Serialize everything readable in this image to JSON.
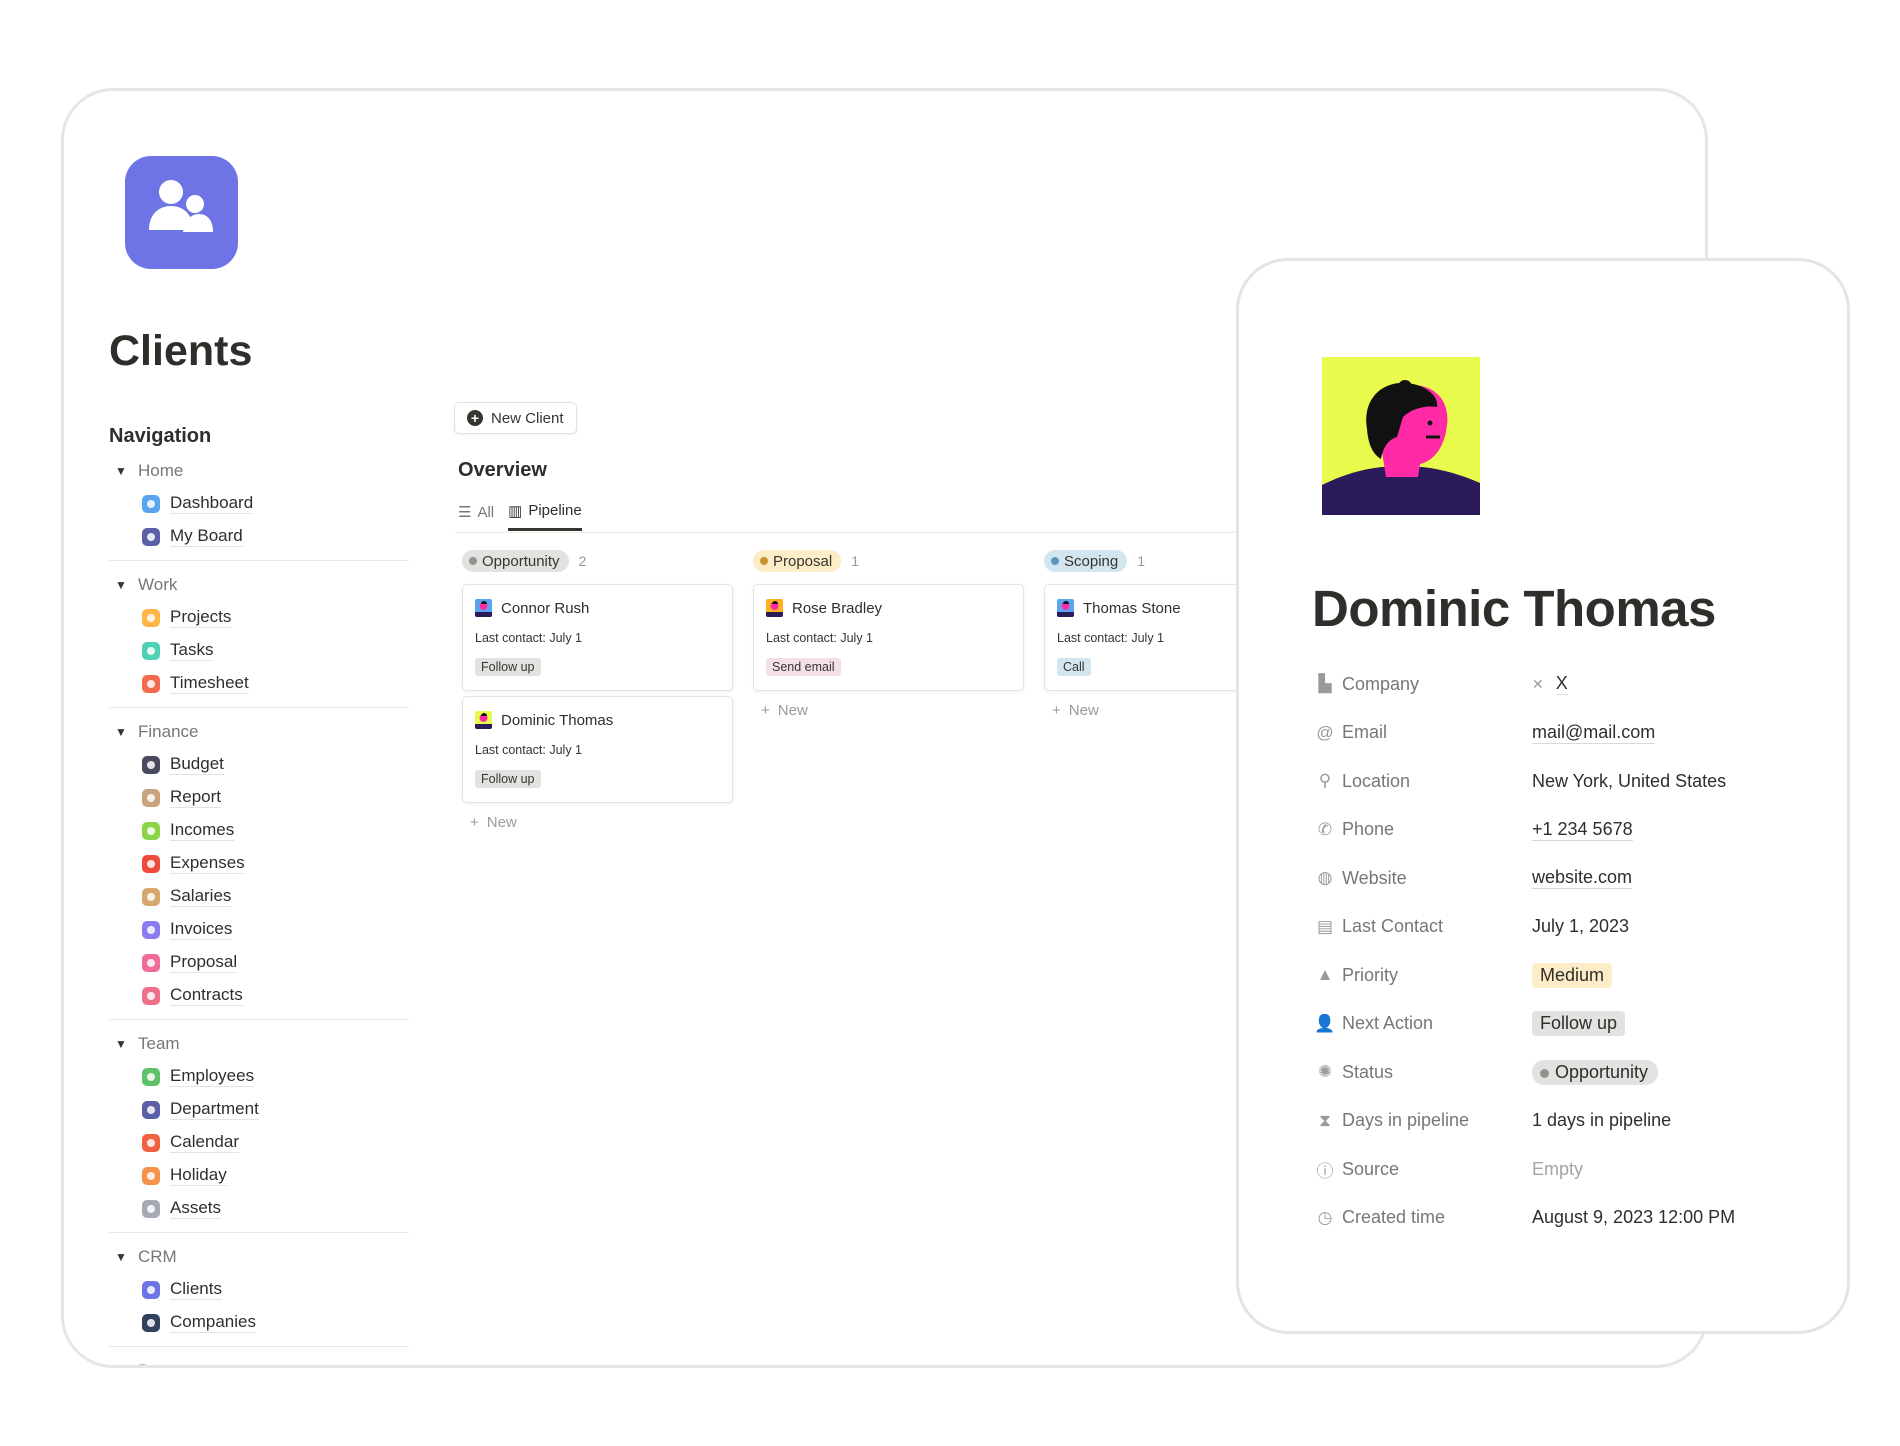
{
  "page": {
    "title": "Clients",
    "nav_title": "Navigation",
    "app_icon": "people-icon"
  },
  "sidebar": {
    "sections": [
      {
        "label": "Home",
        "items": [
          {
            "label": "Dashboard",
            "color": "#5aa5f0"
          },
          {
            "label": "My Board",
            "color": "#5a5fa8"
          }
        ]
      },
      {
        "label": "Work",
        "items": [
          {
            "label": "Projects",
            "color": "#ffb547"
          },
          {
            "label": "Tasks",
            "color": "#4fd1b5"
          },
          {
            "label": "Timesheet",
            "color": "#f26b4f"
          }
        ]
      },
      {
        "label": "Finance",
        "items": [
          {
            "label": "Budget",
            "color": "#4b4b5e"
          },
          {
            "label": "Report",
            "color": "#c9a27e"
          },
          {
            "label": "Incomes",
            "color": "#8bd44a"
          },
          {
            "label": "Expenses",
            "color": "#ee4b3b"
          },
          {
            "label": "Salaries",
            "color": "#d7a86e"
          },
          {
            "label": "Invoices",
            "color": "#8a7cf0"
          },
          {
            "label": "Proposal",
            "color": "#f06a9a"
          },
          {
            "label": "Contracts",
            "color": "#f0708a"
          }
        ]
      },
      {
        "label": "Team",
        "items": [
          {
            "label": "Employees",
            "color": "#5ec26a"
          },
          {
            "label": "Department",
            "color": "#5a5fa8"
          },
          {
            "label": "Calendar",
            "color": "#f2613f"
          },
          {
            "label": "Holiday",
            "color": "#f7924a"
          },
          {
            "label": "Assets",
            "color": "#a5a9b5"
          }
        ]
      },
      {
        "label": "CRM",
        "items": [
          {
            "label": "Clients",
            "color": "#6e74e6"
          },
          {
            "label": "Companies",
            "color": "#33415c"
          }
        ]
      },
      {
        "label": "Base",
        "items": []
      }
    ]
  },
  "main": {
    "new_client": "New Client",
    "overview": "Overview",
    "tabs": [
      {
        "label": "All",
        "icon": "list-icon"
      },
      {
        "label": "Pipeline",
        "icon": "board-icon",
        "active": true
      }
    ],
    "new_label": "New",
    "columns": [
      {
        "label": "Opportunity",
        "count": "2",
        "bg": "#e3e2e0",
        "dot": "#91918e",
        "cards": [
          {
            "name": "Connor Rush",
            "last": "Last contact: July 1",
            "tag": "Follow up",
            "tag_bg": "#e3e2e0",
            "av": "#5aa5f0"
          },
          {
            "name": "Dominic Thomas",
            "last": "Last contact: July 1",
            "tag": "Follow up",
            "tag_bg": "#e3e2e0",
            "av": "#e8fa4b"
          }
        ]
      },
      {
        "label": "Proposal",
        "count": "1",
        "bg": "#fdecc8",
        "dot": "#cb912f",
        "cards": [
          {
            "name": "Rose Bradley",
            "last": "Last contact: July 1",
            "tag": "Send email",
            "tag_bg": "#f5e0e9",
            "av": "#ffb020"
          }
        ]
      },
      {
        "label": "Scoping",
        "count": "1",
        "bg": "#d3e5ef",
        "dot": "#5b97bd",
        "cards": [
          {
            "name": "Thomas Stone",
            "last": "Last contact: July 1",
            "tag": "Call",
            "tag_bg": "#d3e5ef",
            "av": "#5aa5f0"
          }
        ]
      }
    ]
  },
  "detail": {
    "name": "Dominic Thomas",
    "properties": [
      {
        "label": "Company",
        "icon": "building-icon",
        "glyph": "▙",
        "value": "X",
        "prefix": "✕",
        "kind": "link"
      },
      {
        "label": "Email",
        "icon": "at-icon",
        "glyph": "@",
        "value": "mail@mail.com",
        "kind": "link"
      },
      {
        "label": "Location",
        "icon": "pin-icon",
        "glyph": "⚲",
        "value": "New York, United States",
        "kind": "text"
      },
      {
        "label": "Phone",
        "icon": "phone-icon",
        "glyph": "✆",
        "value": "+1 234 5678",
        "kind": "link"
      },
      {
        "label": "Website",
        "icon": "globe-icon",
        "glyph": "◍",
        "value": "website.com",
        "kind": "link"
      },
      {
        "label": "Last Contact",
        "icon": "calendar-icon",
        "glyph": "▤",
        "value": "July 1, 2023",
        "kind": "text"
      },
      {
        "label": "Priority",
        "icon": "warning-icon",
        "glyph": "▲",
        "value": "Medium",
        "kind": "tag",
        "bg": "#fdecc8"
      },
      {
        "label": "Next Action",
        "icon": "person-check-icon",
        "glyph": "👤",
        "value": "Follow up",
        "kind": "tag",
        "bg": "#e3e2e0"
      },
      {
        "label": "Status",
        "icon": "status-icon",
        "glyph": "✺",
        "value": "Opportunity",
        "kind": "status",
        "bg": "#e3e2e0"
      },
      {
        "label": "Days in pipeline",
        "icon": "hourglass-icon",
        "glyph": "⧗",
        "value": "1 days in pipeline",
        "kind": "text"
      },
      {
        "label": "Source",
        "icon": "info-icon",
        "glyph": "ⓘ",
        "value": "Empty",
        "kind": "empty"
      },
      {
        "label": "Created time",
        "icon": "clock-icon",
        "glyph": "◷",
        "value": "August 9, 2023 12:00 PM",
        "kind": "text"
      }
    ]
  }
}
